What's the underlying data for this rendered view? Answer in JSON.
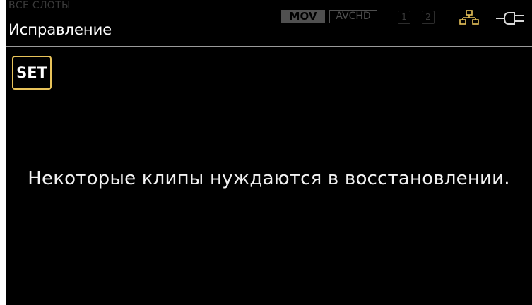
{
  "header": {
    "ghost_label": "ВСЕ СЛОТЫ",
    "title": "Исправление"
  },
  "status_bar": {
    "format_active": "MOV",
    "format_inactive": "AVCHD",
    "slots": [
      "1",
      "2"
    ],
    "network_icon": "network-icon",
    "power_icon": "power-plug-icon"
  },
  "set_button": {
    "label": "SET"
  },
  "message": {
    "text": "Некоторые клипы нуждаются в восстановлении."
  },
  "colors": {
    "background": "#000000",
    "accent": "#e8c35a",
    "network_icon": "#e8c35a",
    "inactive": "#505050"
  }
}
